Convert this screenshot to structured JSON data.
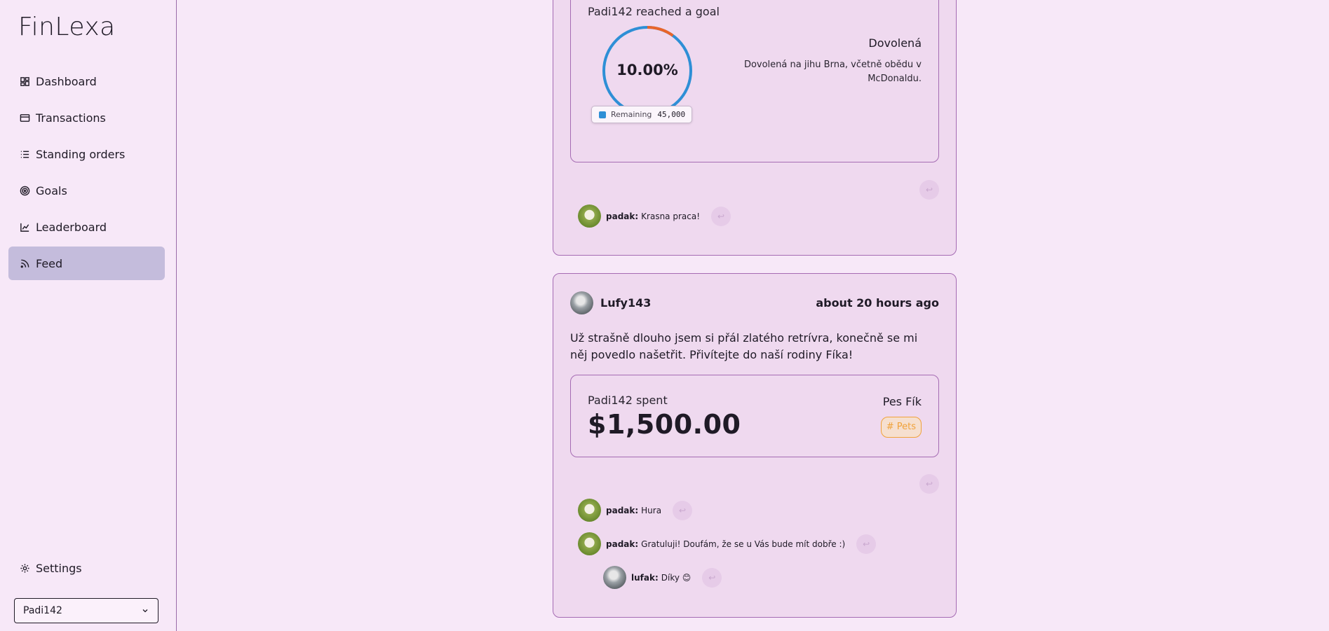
{
  "app": {
    "logo": "FinLexa"
  },
  "sidebar": {
    "items": [
      {
        "label": "Dashboard",
        "icon": "dashboard-icon",
        "active": false
      },
      {
        "label": "Transactions",
        "icon": "card-icon",
        "active": false
      },
      {
        "label": "Standing orders",
        "icon": "list-icon",
        "active": false
      },
      {
        "label": "Goals",
        "icon": "target-icon",
        "active": false
      },
      {
        "label": "Leaderboard",
        "icon": "chart-line-icon",
        "active": false
      },
      {
        "label": "Feed",
        "icon": "rss-icon",
        "active": true
      }
    ],
    "settings_label": "Settings",
    "user_select": {
      "value": "Padi142"
    }
  },
  "feed": {
    "post1": {
      "header": "Padi142 reached a goal",
      "goal_percent": "10.00%",
      "goal_progress": 0.1,
      "goal_name": "Dovolená",
      "goal_description": "Dovolená na jihu Brna, včetně obědu v McDonaldu.",
      "tooltip": {
        "label": "Remaining",
        "value": "45,000"
      },
      "comments": [
        {
          "user": "padak:",
          "text": "Krasna praca!"
        }
      ]
    },
    "post2": {
      "author": "Lufy143",
      "time": "about 20 hours ago",
      "text": "Už strašně dlouho jsem si přál zlatého retrívra, konečně se mi něj povedlo našetřit. Přivítejte do naší rodiny Fíka!",
      "spent_label": "Padi142 spent",
      "amount": "$1,500.00",
      "item_name": "Pes Fík",
      "tag": "# Pets",
      "comments": [
        {
          "user": "padak:",
          "text": "Hura"
        },
        {
          "user": "padak:",
          "text": "Gratuluji! Doufám, že se u Vás bude mít dobře :)"
        },
        {
          "user": "lufak:",
          "text": "Díky 😊"
        }
      ]
    }
  },
  "colors": {
    "background": "#f7e8f8",
    "card": "#efd9ef",
    "border": "#a56bb3",
    "active_nav": "#c4bcdc",
    "progress_blue": "#2e8fd6",
    "progress_orange": "#e8652a",
    "tag_orange": "#f0a23a"
  }
}
